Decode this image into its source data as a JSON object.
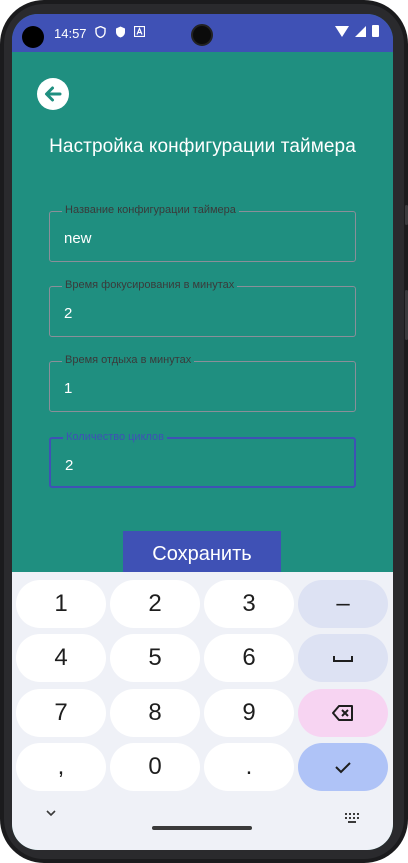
{
  "status_bar": {
    "time": "14:57",
    "icons": [
      "shield-icon",
      "shield-filled-icon",
      "a-icon",
      "wifi-icon",
      "signal-icon",
      "battery-icon"
    ]
  },
  "header": {
    "back_icon": "arrow-left-icon",
    "title": "Настройка конфигурации таймера"
  },
  "form": {
    "fields": [
      {
        "label": "Название конфигурации таймера",
        "value": "new"
      },
      {
        "label": "Время фокусирования в минутах",
        "value": "2"
      },
      {
        "label": "Время отдыха в минутах",
        "value": "1"
      },
      {
        "label": "Количество циклов",
        "value": "2"
      }
    ],
    "save_label": "Сохранить"
  },
  "keyboard": {
    "keys": [
      [
        "1",
        "2",
        "3",
        "–"
      ],
      [
        "4",
        "5",
        "6",
        "space-icon"
      ],
      [
        "7",
        "8",
        "9",
        "backspace-icon"
      ],
      [
        ",",
        "0",
        ".",
        "check-icon"
      ]
    ]
  },
  "colors": {
    "background": "#1f8f80",
    "accent": "#3f51b5",
    "keyboard_bg": "#eff1f7",
    "key_function": "#dde2f3",
    "key_backspace": "#f7d4f2",
    "key_enter": "#afc3f7"
  }
}
